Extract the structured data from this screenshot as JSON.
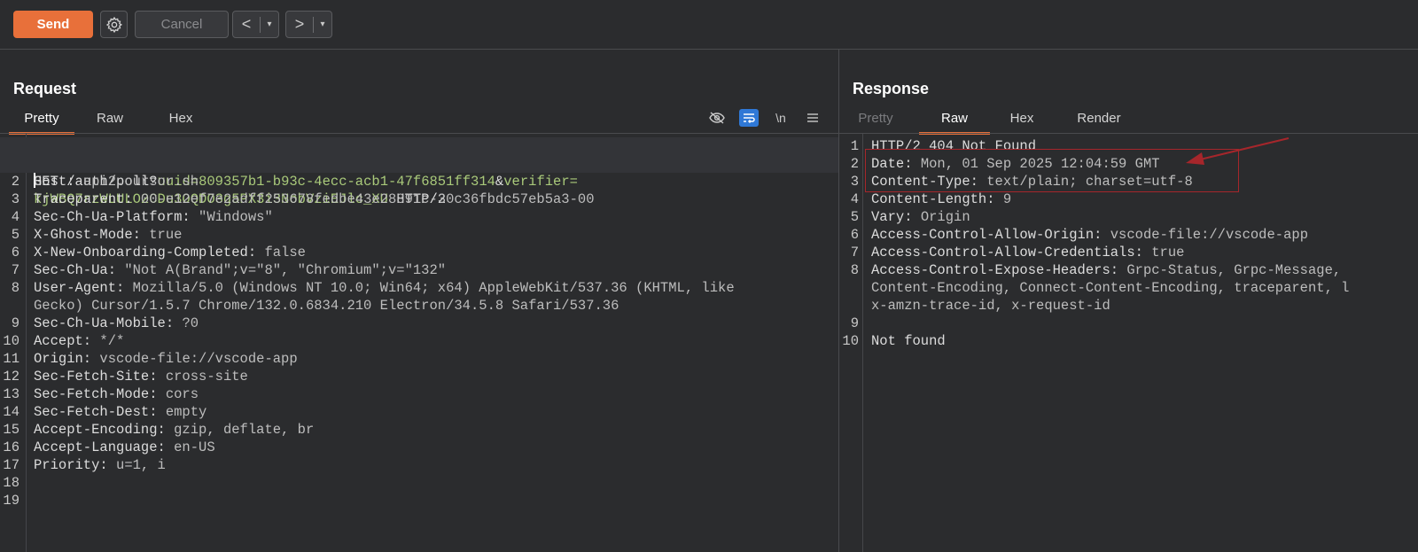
{
  "toolbar": {
    "send_label": "Send",
    "cancel_label": "Cancel",
    "back_label": "<",
    "forward_label": ">",
    "caret": "▾"
  },
  "request": {
    "title": "Request",
    "tabs": [
      "Pretty",
      "Raw",
      "Hex"
    ],
    "active_tab": "Pretty",
    "newline_toggle": "\\n",
    "lines": [
      {
        "n": "1",
        "method": "GET ",
        "path": "/auth/poll?",
        "p1k": "uuid=",
        "p1v": "809357b1-b93c-4ecc-acb1-47f6851ff314",
        "amp": "&",
        "p2k": "verifier="
      },
      {
        "n": "",
        "cont": "kjWBQ7rzWLULO2CDu3OQDO3g5PX3i3NobVziEJlc_XU",
        "proto": " HTTP/2"
      },
      {
        "n": "2",
        "k": "Host:",
        "v": " api2.cursor.sh"
      },
      {
        "n": "3",
        "k": "Traceparent:",
        "v": " 00-e12ef7e2adff253678fedbe43e28891c-30c36fbdc57eb5a3-00"
      },
      {
        "n": "4",
        "k": "Sec-Ch-Ua-Platform:",
        "v": " \"Windows\""
      },
      {
        "n": "5",
        "k": "X-Ghost-Mode:",
        "v": " true"
      },
      {
        "n": "6",
        "k": "X-New-Onboarding-Completed:",
        "v": " false"
      },
      {
        "n": "7",
        "k": "Sec-Ch-Ua:",
        "v": " \"Not A(Brand\";v=\"8\", \"Chromium\";v=\"132\""
      },
      {
        "n": "8",
        "k": "User-Agent:",
        "v": " Mozilla/5.0 (Windows NT 10.0; Win64; x64) AppleWebKit/537.36 (KHTML, like"
      },
      {
        "n": "",
        "k": "",
        "v": "Gecko) Cursor/1.5.7 Chrome/132.0.6834.210 Electron/34.5.8 Safari/537.36"
      },
      {
        "n": "9",
        "k": "Sec-Ch-Ua-Mobile:",
        "v": " ?0"
      },
      {
        "n": "10",
        "k": "Accept:",
        "v": " */*"
      },
      {
        "n": "11",
        "k": "Origin:",
        "v": " vscode-file://vscode-app"
      },
      {
        "n": "12",
        "k": "Sec-Fetch-Site:",
        "v": " cross-site"
      },
      {
        "n": "13",
        "k": "Sec-Fetch-Mode:",
        "v": " cors"
      },
      {
        "n": "14",
        "k": "Sec-Fetch-Dest:",
        "v": " empty"
      },
      {
        "n": "15",
        "k": "Accept-Encoding:",
        "v": " gzip, deflate, br"
      },
      {
        "n": "16",
        "k": "Accept-Language:",
        "v": " en-US"
      },
      {
        "n": "17",
        "k": "Priority:",
        "v": " u=1, i"
      },
      {
        "n": "18",
        "k": "",
        "v": ""
      },
      {
        "n": "19",
        "k": "",
        "v": ""
      }
    ]
  },
  "response": {
    "title": "Response",
    "tabs": [
      "Pretty",
      "Raw",
      "Hex",
      "Render"
    ],
    "active_tab": "Raw",
    "lines": [
      {
        "n": "1",
        "k": "HTTP/2 404 Not Found",
        "v": ""
      },
      {
        "n": "2",
        "k": "Date:",
        "v": " Mon, 01 Sep 2025 12:04:59 GMT"
      },
      {
        "n": "3",
        "k": "Content-Type:",
        "v": " text/plain; charset=utf-8"
      },
      {
        "n": "4",
        "k": "Content-Length:",
        "v": " 9"
      },
      {
        "n": "5",
        "k": "Vary:",
        "v": " Origin"
      },
      {
        "n": "6",
        "k": "Access-Control-Allow-Origin:",
        "v": " vscode-file://vscode-app"
      },
      {
        "n": "7",
        "k": "Access-Control-Allow-Credentials:",
        "v": " true"
      },
      {
        "n": "8",
        "k": "Access-Control-Expose-Headers:",
        "v": " Grpc-Status, Grpc-Message,"
      },
      {
        "n": "",
        "k": "",
        "v": "Content-Encoding, Connect-Content-Encoding, traceparent, l"
      },
      {
        "n": "",
        "k": "",
        "v": "x-amzn-trace-id, x-request-id"
      },
      {
        "n": "9",
        "k": "",
        "v": ""
      },
      {
        "n": "10",
        "k": "",
        "v": "Not found"
      }
    ]
  },
  "colors": {
    "accent": "#e8703a",
    "annotation": "#a6262b",
    "param_value": "#a9c97a",
    "active_icon": "#2f78d6"
  }
}
